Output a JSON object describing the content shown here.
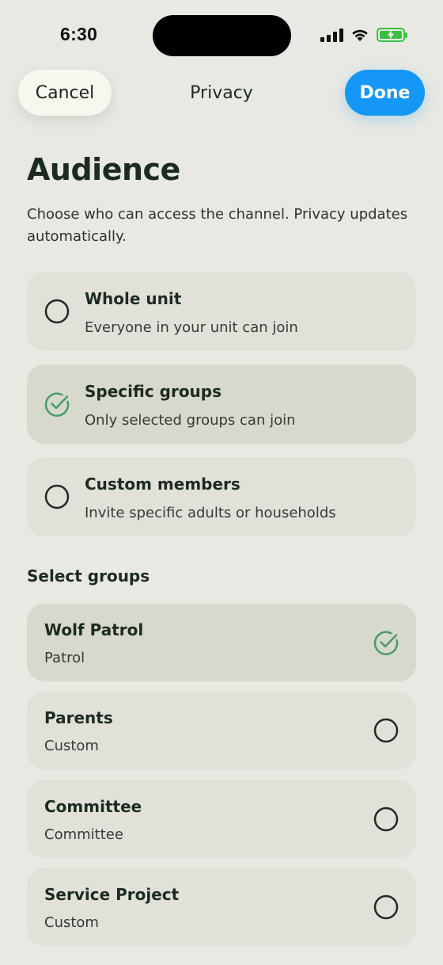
{
  "status_bar": {
    "time": "6:30"
  },
  "nav": {
    "cancel_label": "Cancel",
    "title": "Privacy",
    "done_label": "Done"
  },
  "audience": {
    "heading": "Audience",
    "description": "Choose who can access the channel. Privacy updates automatically.",
    "options": [
      {
        "title": "Whole unit",
        "subtitle": "Everyone in your unit can join",
        "selected": false
      },
      {
        "title": "Specific groups",
        "subtitle": "Only selected groups can join",
        "selected": true
      },
      {
        "title": "Custom members",
        "subtitle": "Invite specific adults or households",
        "selected": false
      }
    ]
  },
  "groups_section": {
    "label": "Select groups",
    "groups": [
      {
        "name": "Wolf Patrol",
        "type": "Patrol",
        "selected": true
      },
      {
        "name": "Parents",
        "type": "Custom",
        "selected": false
      },
      {
        "name": "Committee",
        "type": "Committee",
        "selected": false
      },
      {
        "name": "Service Project",
        "type": "Custom",
        "selected": false
      }
    ]
  },
  "colors": {
    "accent_blue": "#1598f5",
    "check_green": "#4a9a6a",
    "battery_green": "#3bbf45",
    "background": "#e9e9e3"
  }
}
